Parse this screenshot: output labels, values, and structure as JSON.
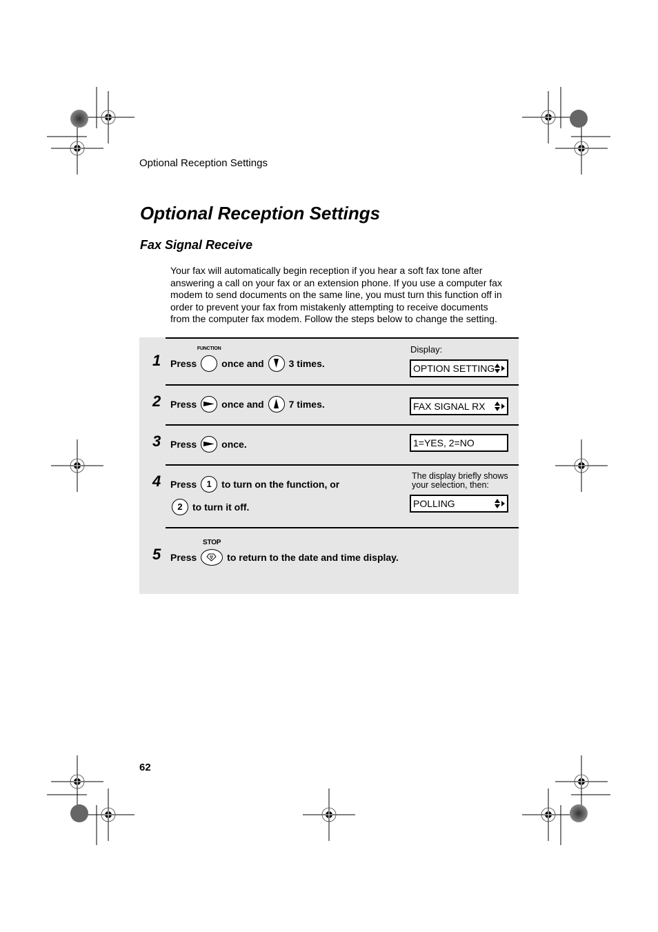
{
  "header": {
    "running_head": "Optional Reception Settings"
  },
  "page_title": "Optional Reception Settings",
  "section_title": "Fax Signal Receive",
  "intro_lines": [
    "Your fax will automatically begin reception if you hear a soft fax tone after",
    "answering a call on your fax or an extension phone. If you use a computer fax",
    "modem to send documents on the same line, you must turn this function off in",
    "order to prevent your fax from mistakenly attempting to receive documents",
    "from the computer fax modem. Follow the steps below to change the setting."
  ],
  "steps": [
    {
      "number": "1",
      "press": "Press",
      "key1_label": "FUNCTION",
      "text_mid": "once and",
      "key2_icon": "down-arrow-key",
      "text_end": "3 times.",
      "display_caption": "Display:",
      "display": "OPTION SETTING"
    },
    {
      "number": "2",
      "press": "Press",
      "key1_icon": "right-arrow-key",
      "text_mid": "once and",
      "key2_icon": "up-arrow-key",
      "text_end": "7 times.",
      "display": "FAX SIGNAL RX"
    },
    {
      "number": "3",
      "press": "Press",
      "key1_icon": "right-arrow-key",
      "text_end": "once.",
      "display": "1=YES, 2=NO"
    },
    {
      "number": "4",
      "press": "Press",
      "key1_label": "1",
      "text_mid": "to turn on the function, or",
      "key2_label": "2",
      "text_end": "to turn it off.",
      "display_caption_1": "The display briefly shows",
      "display_caption_2": "your selection, then:",
      "display": "POLLING"
    },
    {
      "number": "5",
      "press": "Press",
      "key1_label": "STOP",
      "text_end": "to return to the date and time display."
    }
  ],
  "footer": {
    "page_number": "62"
  }
}
